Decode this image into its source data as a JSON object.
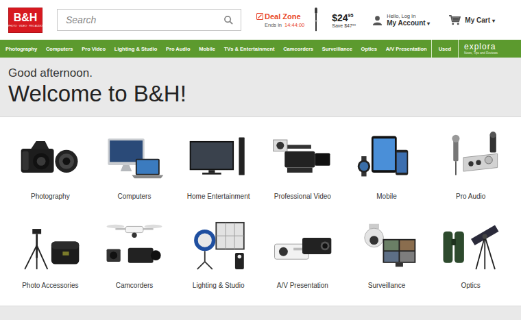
{
  "logo": {
    "text": "B&H",
    "tagline": "PHOTO · VIDEO · PRO AUDIO"
  },
  "search": {
    "placeholder": "Search"
  },
  "deal_zone": {
    "title": "Deal Zone",
    "ends_label": "Ends in",
    "countdown": "14:44:00",
    "price": "$24",
    "cents": "95",
    "save": "Save $47**"
  },
  "account": {
    "greeting": "Hello, Log In",
    "label": "My Account",
    "caret": "▾"
  },
  "cart": {
    "label": "My Cart",
    "caret": "▾"
  },
  "nav": {
    "items": [
      "Photography",
      "Computers",
      "Pro Video",
      "Lighting & Studio",
      "Pro Audio",
      "Mobile",
      "TVs & Entertainment",
      "Camcorders",
      "Surveillance",
      "Optics",
      "A/V Presentation"
    ],
    "used": "Used",
    "explora": {
      "name": "explora",
      "tagline": "News, Tips and Reviews"
    }
  },
  "greeting": {
    "line1": "Good afternoon.",
    "line2": "Welcome to B&H!"
  },
  "categories": [
    {
      "label": "Photography"
    },
    {
      "label": "Computers"
    },
    {
      "label": "Home Entertainment"
    },
    {
      "label": "Professional Video"
    },
    {
      "label": "Mobile"
    },
    {
      "label": "Pro Audio"
    },
    {
      "label": "Photo Accessories"
    },
    {
      "label": "Camcorders"
    },
    {
      "label": "Lighting & Studio"
    },
    {
      "label": "A/V Presentation"
    },
    {
      "label": "Surveillance"
    },
    {
      "label": "Optics"
    }
  ]
}
